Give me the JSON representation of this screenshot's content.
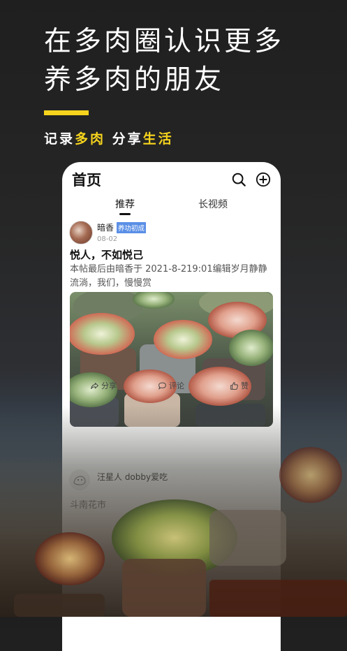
{
  "headline": {
    "line1": "在多肉圈认识更多",
    "line2": "养多肉的朋友"
  },
  "tagline": {
    "part1": "记录",
    "part2": "多肉",
    "part3": "分享",
    "part4": "生活"
  },
  "colors": {
    "accent": "#f6d41d",
    "badge": "#5b8fe6"
  },
  "app": {
    "title": "首页",
    "icons": [
      "search-icon",
      "add-icon"
    ],
    "tabs": [
      {
        "label": "推荐",
        "active": true
      },
      {
        "label": "长视频",
        "active": false
      }
    ]
  },
  "post": {
    "username": "暗香",
    "badge": "养功初成",
    "date": "08-02",
    "title": "悦人，不如悦己",
    "body": "本帖最后由暗香于 2021-8-219:01编辑岁月静静流淌，我们，慢慢赏",
    "actions": {
      "share": "分享",
      "comment": "评论",
      "like": "赞"
    }
  },
  "post2": {
    "username": "汪星人 dobby爱吃",
    "snippet": "斗南花市"
  }
}
